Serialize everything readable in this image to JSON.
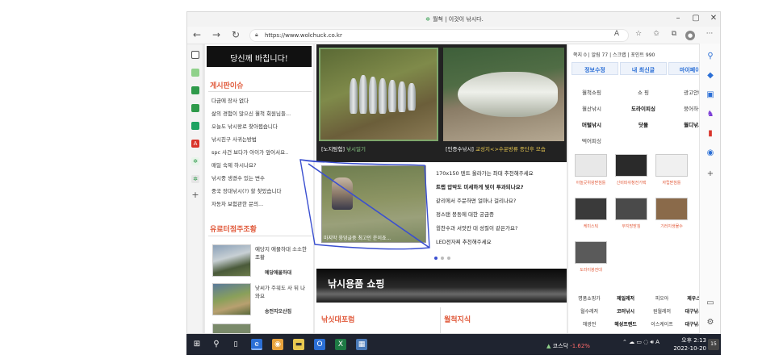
{
  "browser": {
    "tab_title": "월척 | 이것이 낚시다.",
    "url": "https://www.wolchuck.co.kr",
    "win_min": "–",
    "win_max": "▢",
    "win_close": "✕"
  },
  "left_col": {
    "banner": "당신께 바칩니다!",
    "board_title": "게시판이슈",
    "board_items": [
      "다금에 장사 없다",
      "삶의 경험이 많으신 월척 회원님들...",
      "오늘도 낚시왕로 찾아뵙습니다",
      "낚시친구 사귀는방법",
      "spc 사건 보다가 아이가 앞어서요..",
      "매일 숙제 하시나요?",
      "낚시중 생겼수 있는 변수",
      "중국 장대낚시(?) 할 찾았습니다",
      "자동차 보험관한 문의..."
    ],
    "fishery_title": "유료터점주조황",
    "fishery_items": [
      {
        "text": "예당지 애물하대 소소한조황",
        "source": "예당애물하대"
      },
      {
        "text": "낮씨가 주워도 사 뒤 나와요",
        "source": "송전지오산집"
      }
    ]
  },
  "center": {
    "photo1_caption_prefix": "[노지탐험]",
    "photo1_caption": "낚시일기",
    "photo2_caption_prefix": "[인증수낚시]",
    "photo2_caption": "교성지<>수운방류 종단후 모습",
    "video_caption": "마지막 웅덩글중 최고인 운이죠...",
    "video_items": [
      "170x150 텐트 올라가는 좌대 추천해주세요",
      "트랩 압막도 미세하게 빛이 투과되나요?",
      "같리에서 주문하면 얼마나 걸리나요?",
      "정스탠 붕동에 대한 궁금증",
      "윙찬수과 서앗칸 대 성질이 같은가요?",
      "LED전자찌 추천해주세요"
    ],
    "ad_text": "낚시용품 쇼핑",
    "bottom_left_title": "낚싯대포럼",
    "bottom_right_title": "월척지식"
  },
  "right_col": {
    "stats": "쪽지 0 | 알림 77 | 스크랩 | 포인트 990",
    "buttons": [
      "정보수정",
      "내 최신글",
      "마이페이지"
    ],
    "grid": [
      [
        "월척쇼핑",
        "쇼 핑",
        "광고안내"
      ],
      [
        "월산낚시",
        "도라이피싱",
        "붕어하늘"
      ],
      [
        "머털낚시",
        "닷몰",
        "월디낚시"
      ],
      [
        "떡어피싱",
        "",
        ""
      ]
    ],
    "items": [
      {
        "label": "아놀곳위왕받침틀"
      },
      {
        "label": "신비피쉬청전기택"
      },
      {
        "label": "자립받침틀"
      },
      {
        "label": "케미스틱"
      },
      {
        "label": "무지방받침"
      },
      {
        "label": "기러지생물수"
      },
      {
        "label": "도라이붕전대"
      }
    ],
    "bottom_grid": [
      [
        "명품쇼핑가",
        "제일레저",
        "피오아",
        "제우스레저"
      ],
      [
        "월수레저",
        "코러낚시",
        "원월레저",
        "대구낚시용품"
      ],
      [
        "해광전",
        "해성프랜드",
        "이스케이프",
        "대구낚시용품"
      ]
    ]
  },
  "taskbar": {
    "stock_name": "코스닥",
    "stock_change": "-1.62%",
    "time": "오후 2:13",
    "date": "2022-10-20",
    "lang": "A",
    "notif": "15"
  },
  "colors": {
    "accent_orange": "#e0593a",
    "link_blue": "#2b6fd6",
    "taskbar": "#1f2430",
    "annotation": "#3a4fd0"
  }
}
